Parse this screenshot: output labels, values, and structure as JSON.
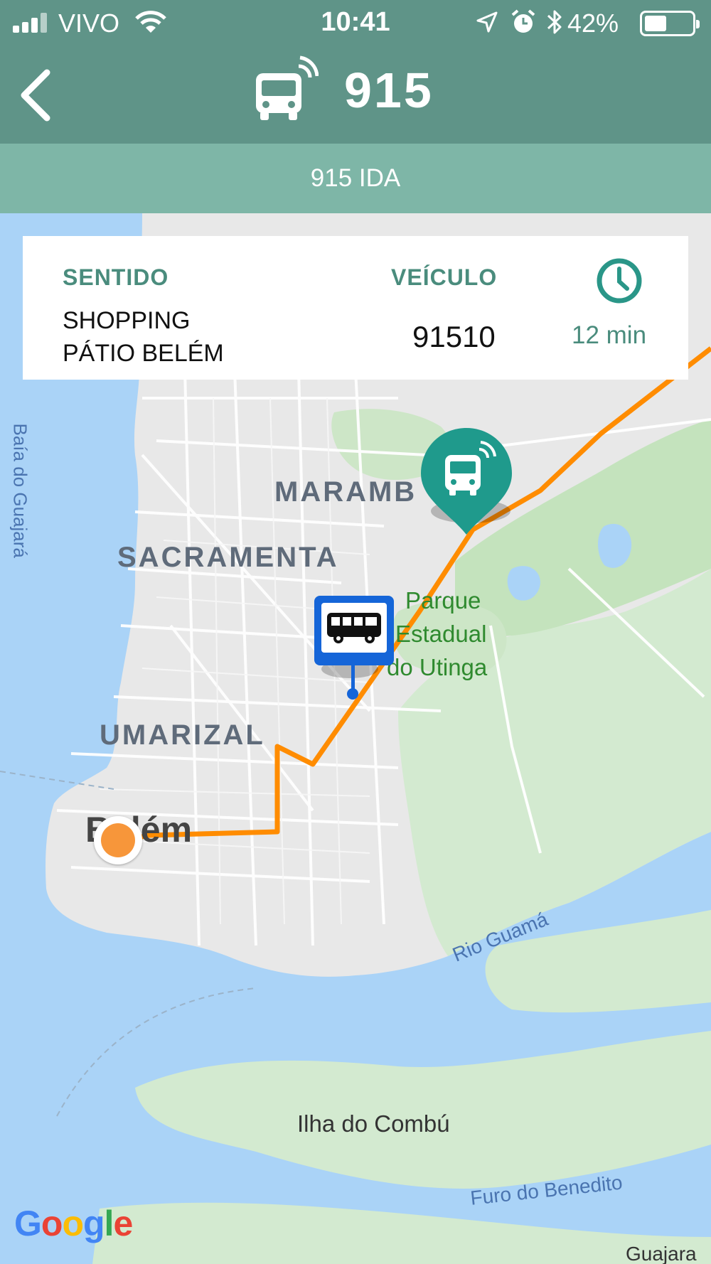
{
  "status_bar": {
    "carrier": "VIVO",
    "time": "10:41",
    "battery": "42%",
    "battery_level": 0.42,
    "icons": [
      "signal-icon",
      "wifi-icon",
      "location-arrow-icon",
      "alarm-icon",
      "bluetooth-icon",
      "battery-icon"
    ]
  },
  "header": {
    "title": "915",
    "subtitle": "915 IDA",
    "back_icon": "chevron-left-icon",
    "bus_icon": "bus-realtime-icon"
  },
  "info_card": {
    "direction_label": "SENTIDO",
    "direction_line1": "SHOPPING",
    "direction_line2": "PÁTIO BELÉM",
    "vehicle_label": "VEÍCULO",
    "vehicle_value": "91510",
    "time_value": "12 min",
    "clock_icon": "clock-icon"
  },
  "map": {
    "labels": {
      "marambaia": "MARAMB",
      "sacramenta": "SACRAMENTA",
      "umarizal": "UMARIZAL",
      "belem": "Belém",
      "parque1": "Parque",
      "parque2": "Estadual",
      "parque3": "do Utinga",
      "rio_guama": "Rio Guamá",
      "ilha": "Ilha do Combú",
      "furo": "Furo do Benedito",
      "baia": "Baía do Guajará",
      "guajara": "Guajara"
    },
    "route_color": "#ff8c00",
    "bus_marker_color": "#1f9a8c",
    "stop_marker_color": "#1565d8",
    "attribution": "Google"
  }
}
